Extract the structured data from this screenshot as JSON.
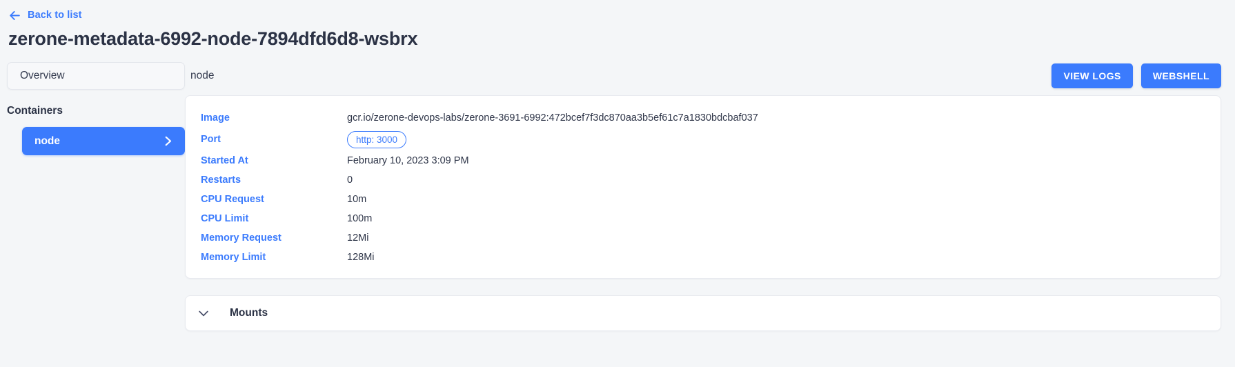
{
  "nav": {
    "back_label": "Back to list",
    "back_icon": "arrow-left-icon"
  },
  "page_title": "zerone-metadata-6992-node-7894dfd6d8-wsbrx",
  "sidebar": {
    "overview_tab_label": "Overview",
    "containers_heading": "Containers",
    "containers": [
      {
        "label": "node",
        "selected": true,
        "chevron_icon": "chevron-right-icon"
      }
    ]
  },
  "content": {
    "title": "node",
    "actions": [
      {
        "label": "VIEW LOGS",
        "name": "view-logs-button"
      },
      {
        "label": "WEBSHELL",
        "name": "webshell-button"
      }
    ],
    "details": [
      {
        "key": "Image",
        "value": "gcr.io/zerone-devops-labs/zerone-3691-6992:472bcef7f3dc870aa3b5ef61c7a1830bdcbaf037",
        "type": "text"
      },
      {
        "key": "Port",
        "value": "http: 3000",
        "type": "chip"
      },
      {
        "key": "Started At",
        "value": "February 10, 2023 3:09 PM",
        "type": "text"
      },
      {
        "key": "Restarts",
        "value": "0",
        "type": "text"
      },
      {
        "key": "CPU Request",
        "value": "10m",
        "type": "text"
      },
      {
        "key": "CPU Limit",
        "value": "100m",
        "type": "text"
      },
      {
        "key": "Memory Request",
        "value": "12Mi",
        "type": "text"
      },
      {
        "key": "Memory Limit",
        "value": "128Mi",
        "type": "text"
      }
    ],
    "mounts_section": {
      "label": "Mounts",
      "expanded": false,
      "chevron_icon": "chevron-down-icon"
    }
  },
  "colors": {
    "accent": "#3b7bfd",
    "page_background": "#f4f6f8",
    "card_background": "#ffffff",
    "text": "#2e3548",
    "border": "#e8eaef"
  }
}
